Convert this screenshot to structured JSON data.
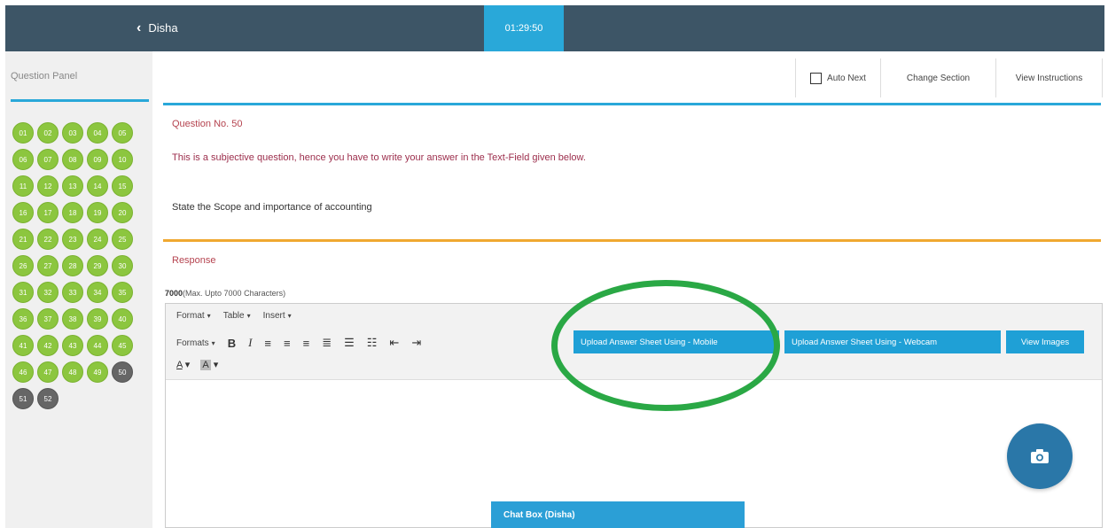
{
  "header": {
    "back_label": "Disha",
    "timer": "01:29:50"
  },
  "sidebar": {
    "title": "Question Panel",
    "questions": [
      {
        "n": "01",
        "status": "answered"
      },
      {
        "n": "02",
        "status": "answered"
      },
      {
        "n": "03",
        "status": "answered"
      },
      {
        "n": "04",
        "status": "answered"
      },
      {
        "n": "05",
        "status": "answered"
      },
      {
        "n": "06",
        "status": "answered"
      },
      {
        "n": "07",
        "status": "answered"
      },
      {
        "n": "08",
        "status": "answered"
      },
      {
        "n": "09",
        "status": "answered"
      },
      {
        "n": "10",
        "status": "answered"
      },
      {
        "n": "11",
        "status": "answered"
      },
      {
        "n": "12",
        "status": "answered"
      },
      {
        "n": "13",
        "status": "answered"
      },
      {
        "n": "14",
        "status": "answered"
      },
      {
        "n": "15",
        "status": "answered"
      },
      {
        "n": "16",
        "status": "answered"
      },
      {
        "n": "17",
        "status": "answered"
      },
      {
        "n": "18",
        "status": "answered"
      },
      {
        "n": "19",
        "status": "answered"
      },
      {
        "n": "20",
        "status": "answered"
      },
      {
        "n": "21",
        "status": "answered"
      },
      {
        "n": "22",
        "status": "answered"
      },
      {
        "n": "23",
        "status": "answered"
      },
      {
        "n": "24",
        "status": "answered"
      },
      {
        "n": "25",
        "status": "answered"
      },
      {
        "n": "26",
        "status": "answered"
      },
      {
        "n": "27",
        "status": "answered"
      },
      {
        "n": "28",
        "status": "answered"
      },
      {
        "n": "29",
        "status": "answered"
      },
      {
        "n": "30",
        "status": "answered"
      },
      {
        "n": "31",
        "status": "answered"
      },
      {
        "n": "32",
        "status": "answered"
      },
      {
        "n": "33",
        "status": "answered"
      },
      {
        "n": "34",
        "status": "answered"
      },
      {
        "n": "35",
        "status": "answered"
      },
      {
        "n": "36",
        "status": "answered"
      },
      {
        "n": "37",
        "status": "answered"
      },
      {
        "n": "38",
        "status": "answered"
      },
      {
        "n": "39",
        "status": "answered"
      },
      {
        "n": "40",
        "status": "answered"
      },
      {
        "n": "41",
        "status": "answered"
      },
      {
        "n": "42",
        "status": "answered"
      },
      {
        "n": "43",
        "status": "answered"
      },
      {
        "n": "44",
        "status": "answered"
      },
      {
        "n": "45",
        "status": "answered"
      },
      {
        "n": "46",
        "status": "answered"
      },
      {
        "n": "47",
        "status": "answered"
      },
      {
        "n": "48",
        "status": "answered"
      },
      {
        "n": "49",
        "status": "answered"
      },
      {
        "n": "50",
        "status": "visited"
      },
      {
        "n": "51",
        "status": "visited"
      },
      {
        "n": "52",
        "status": "visited"
      }
    ]
  },
  "actions": {
    "auto_next": "Auto Next",
    "change_section": "Change Section",
    "view_instructions": "View Instructions"
  },
  "question": {
    "number_label": "Question No. 50",
    "instruction": "This is a subjective question, hence you have to write your answer in the Text-Field given below.",
    "text": "State the Scope and importance of accounting"
  },
  "response": {
    "heading": "Response",
    "limit_value": "7000",
    "limit_text": "(Max. Upto 7000 Characters)"
  },
  "editor": {
    "menus": [
      "Format",
      "Table",
      "Insert"
    ],
    "formats_label": "Formats",
    "upload_mobile": "Upload Answer Sheet Using - Mobile",
    "upload_webcam": "Upload Answer Sheet Using - Webcam",
    "view_images": "View Images"
  },
  "chat": {
    "title": "Chat Box (Disha)"
  },
  "colors": {
    "header": "#3d5566",
    "accent": "#29a8d9",
    "answered": "#8cc63f",
    "visited": "#666666",
    "highlight": "#2aa845"
  }
}
